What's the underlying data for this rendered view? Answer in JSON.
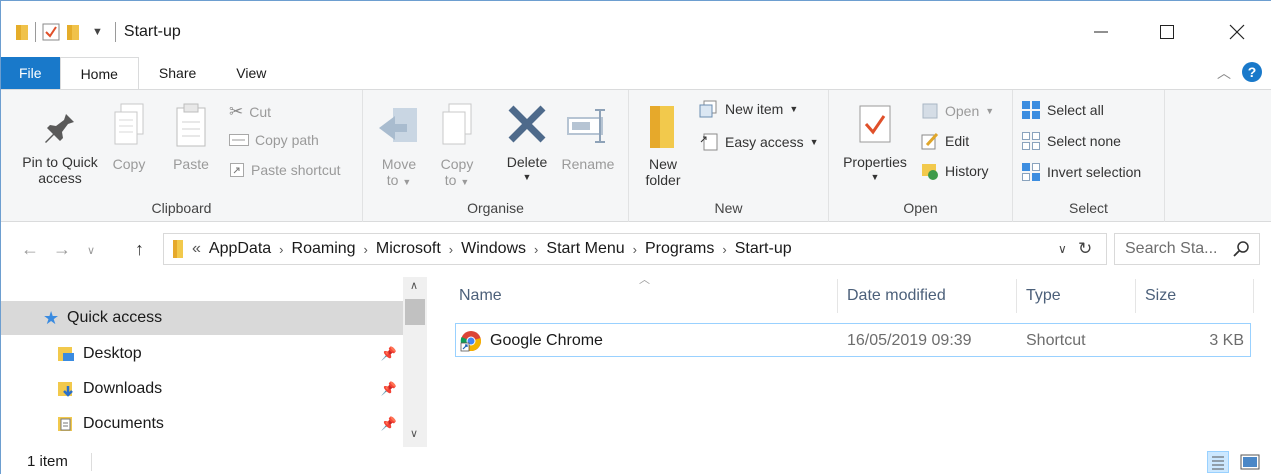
{
  "title": "Start-up",
  "tabs": [
    "File",
    "Home",
    "Share",
    "View"
  ],
  "clipboard": {
    "group_label": "Clipboard",
    "pin_line1": "Pin to Quick",
    "pin_line2": "access",
    "copy": "Copy",
    "paste": "Paste",
    "cut": "Cut",
    "copy_path": "Copy path",
    "paste_shortcut": "Paste shortcut"
  },
  "organise": {
    "group_label": "Organise",
    "move_to": "Move",
    "move_to2": "to",
    "copy_to": "Copy",
    "copy_to2": "to",
    "delete": "Delete",
    "rename": "Rename"
  },
  "new": {
    "group_label": "New",
    "new_folder1": "New",
    "new_folder2": "folder",
    "new_item": "New item",
    "easy_access": "Easy access"
  },
  "open": {
    "group_label": "Open",
    "properties": "Properties",
    "open": "Open",
    "edit": "Edit",
    "history": "History"
  },
  "select": {
    "group_label": "Select",
    "select_all": "Select all",
    "select_none": "Select none",
    "invert": "Invert selection"
  },
  "address": {
    "overflow": "«",
    "crumbs": [
      "AppData",
      "Roaming",
      "Microsoft",
      "Windows",
      "Start Menu",
      "Programs",
      "Start-up"
    ],
    "search_placeholder": "Search Sta..."
  },
  "nav_pane": {
    "items": [
      {
        "label": "Quick access",
        "icon": "star-icon"
      },
      {
        "label": "Desktop",
        "icon": "desktop-folder-icon"
      },
      {
        "label": "Downloads",
        "icon": "downloads-folder-icon"
      },
      {
        "label": "Documents",
        "icon": "documents-folder-icon"
      }
    ]
  },
  "columns": {
    "name": "Name",
    "date": "Date modified",
    "type": "Type",
    "size": "Size"
  },
  "files": [
    {
      "name": "Google Chrome",
      "date": "16/05/2019 09:39",
      "type": "Shortcut",
      "size": "3 KB"
    }
  ],
  "status": {
    "count": "1 item"
  },
  "colors": {
    "accent": "#1979ca",
    "folder": "#f0c24a",
    "selection": "#99d1ff"
  }
}
